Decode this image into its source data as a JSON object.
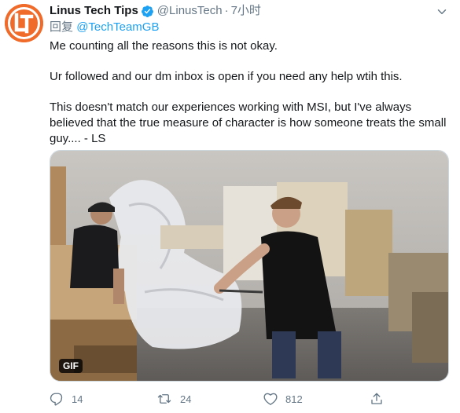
{
  "tweet": {
    "author": {
      "display_name": "Linus Tech Tips",
      "handle": "@LinusTech",
      "verified": true,
      "avatar_icon": "ltt-logo-icon",
      "avatar_color": "#f06b2a"
    },
    "separator": "·",
    "time": "7小时",
    "reply_prefix": "回复",
    "reply_to": "@TechTeamGB",
    "paragraphs": [
      "Me counting all the reasons this is not okay.",
      "Ur followed and our dm inbox is open if you need any help wtih this.",
      "This doesn't match our experiences working with MSI, but I've always believed that the true measure of character is how someone treats the small guy.... - LS"
    ],
    "media": {
      "type": "gif",
      "badge": "GIF"
    },
    "actions": {
      "reply": {
        "icon": "comment-icon",
        "count": "14"
      },
      "retweet": {
        "icon": "retweet-icon",
        "count": "24"
      },
      "like": {
        "icon": "heart-icon",
        "count": "812"
      },
      "share": {
        "icon": "share-icon"
      }
    }
  },
  "colors": {
    "accent": "#1da1f2",
    "secondary_text": "#657786",
    "primary_text": "#14171a"
  }
}
